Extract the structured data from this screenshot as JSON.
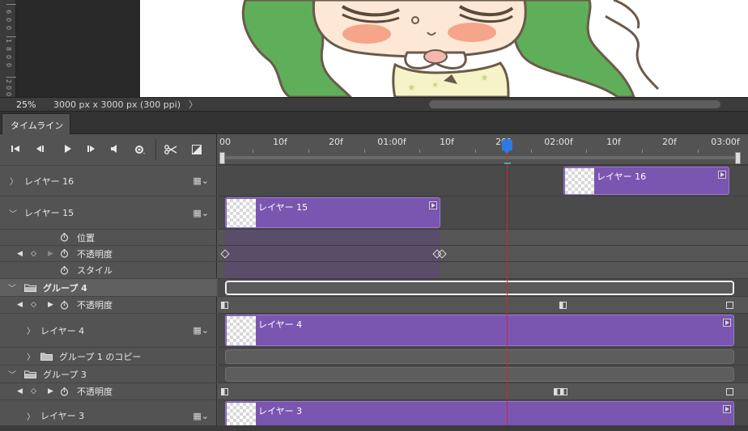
{
  "status_bar": {
    "zoom": "25%",
    "doc_info": "3000 px x 3000 px (300 ppi)",
    "arrow": "〉"
  },
  "ruler_v": [
    "6",
    "0",
    "0",
    "1",
    "8",
    "0",
    "0",
    "2",
    "0",
    "0"
  ],
  "panel": {
    "tab_label": "タイムライン"
  },
  "time_ruler": {
    "labels": [
      "00",
      "10f",
      "20f",
      "01:00f",
      "10f",
      "20f",
      "02:00f",
      "10f",
      "20f",
      "03:00f"
    ]
  },
  "layers": {
    "layer16": {
      "name": "レイヤー 16",
      "clip_label": "レイヤー 16"
    },
    "layer15": {
      "name": "レイヤー 15",
      "clip_label": "レイヤー 15",
      "props": [
        "位置",
        "不透明度",
        "スタイル"
      ]
    },
    "group4": {
      "name": "グループ 4",
      "prop": "不透明度"
    },
    "layer4": {
      "name": "レイヤー 4",
      "clip_label": "レイヤー 4"
    },
    "group1copy": {
      "name": "グループ 1 のコピー"
    },
    "group3": {
      "name": "グループ 3",
      "prop": "不透明度"
    },
    "layer3": {
      "name": "レイヤー 3",
      "clip_label": "レイヤー 3"
    }
  },
  "colors": {
    "clip": "#7a56b0",
    "playhead": "#c8283c",
    "playhead_head": "#2d7be0"
  },
  "icons": [
    "first-frame-icon",
    "prev-frame-icon",
    "play-icon",
    "next-frame-icon",
    "audio-icon",
    "settings-icon",
    "scissors-icon",
    "transition-icon",
    "film-icon",
    "stopwatch-icon",
    "folder-icon",
    "keyframe-icon"
  ]
}
